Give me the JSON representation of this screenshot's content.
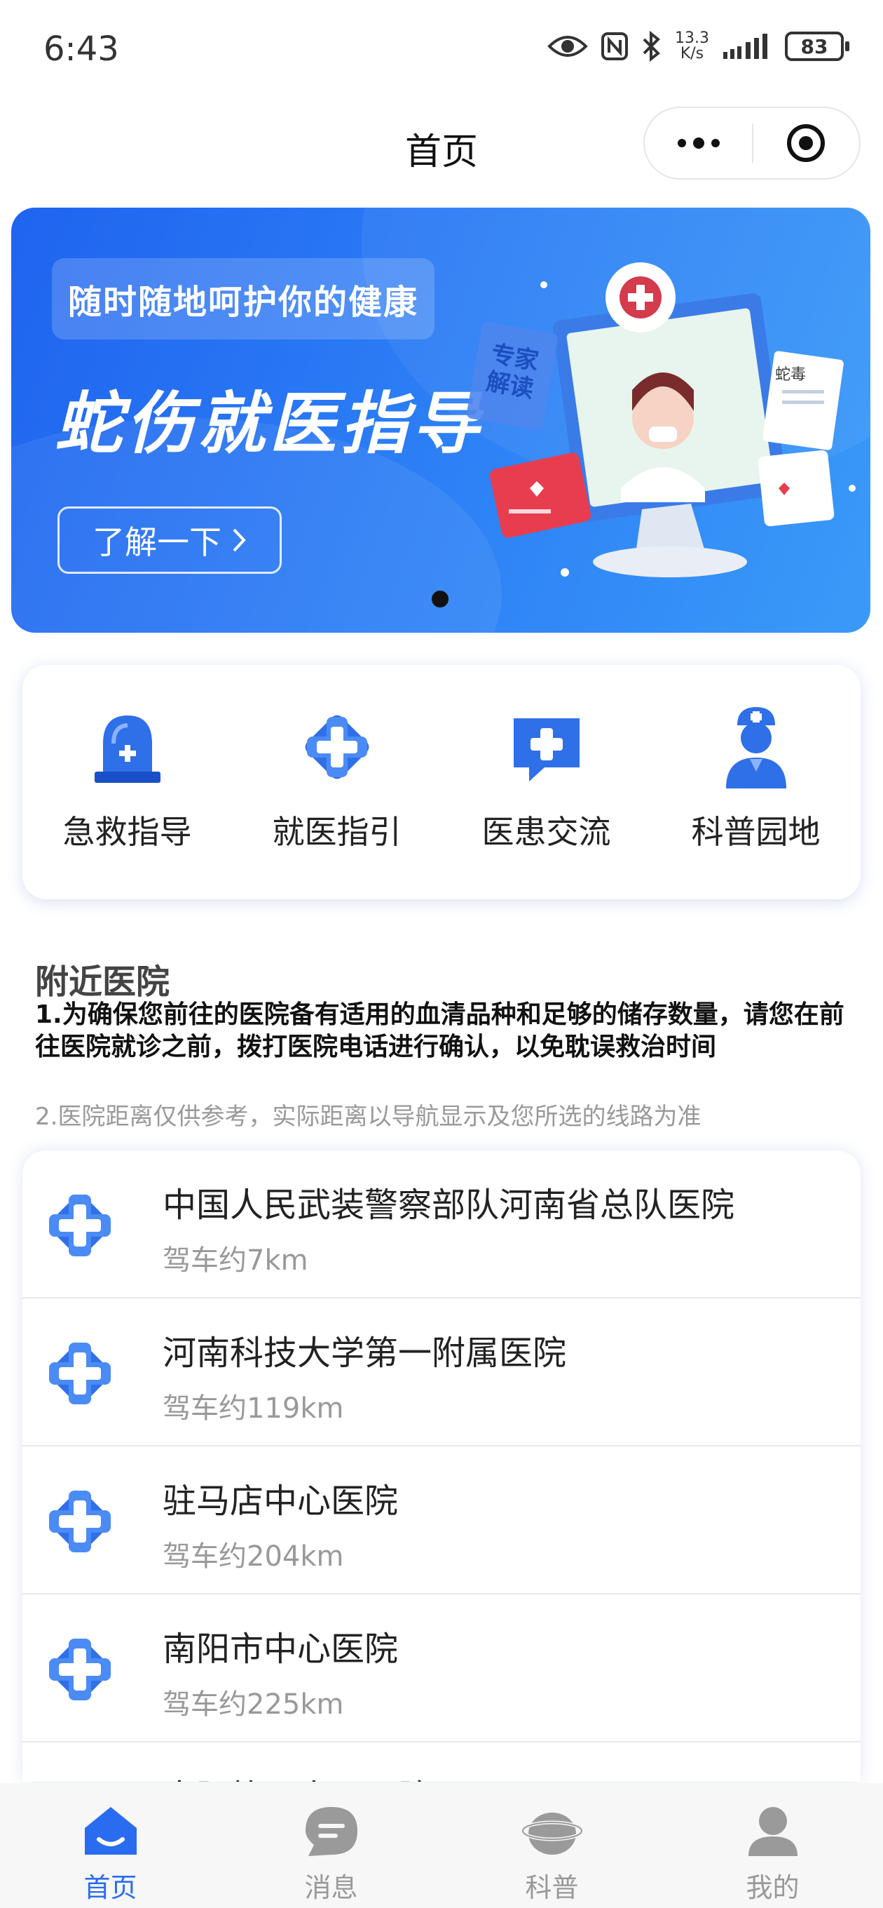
{
  "status_bar": {
    "time": "6:43",
    "net_speed_top": "13.3",
    "net_speed_bottom": "K/s",
    "battery": "83"
  },
  "navbar": {
    "title": "首页"
  },
  "banner": {
    "slogan": "随时随地呵护你的健康",
    "headline": "蛇伤就医指导",
    "button_label": "了解一下",
    "illus_tag_1": "专家",
    "illus_tag_2": "解读",
    "illus_doc_label": "蛇毒"
  },
  "quick_entries": [
    {
      "label": "急救指导",
      "icon": "alarm-light-icon"
    },
    {
      "label": "就医指引",
      "icon": "medical-cross-icon"
    },
    {
      "label": "医患交流",
      "icon": "chat-cross-icon"
    },
    {
      "label": "科普园地",
      "icon": "nurse-icon"
    }
  ],
  "nearby": {
    "title": "附近医院",
    "note1": "1.为确保您前往的医院备有适用的血清品种和足够的储存数量，请您在前往医院就诊之前，拨打医院电话进行确认，以免耽误救治时间",
    "note2": "2.医院距离仅供参考，实际距离以导航显示及您所选的线路为准",
    "hospitals": [
      {
        "name": "中国人民武装警察部队河南省总队医院",
        "distance": "驾车约7km"
      },
      {
        "name": "河南科技大学第一附属医院",
        "distance": "驾车约119km"
      },
      {
        "name": "驻马店中心医院",
        "distance": "驾车约204km"
      },
      {
        "name": "南阳市中心医院",
        "distance": "驾车约225km"
      },
      {
        "name": "南阳第一人民医院",
        "distance": ""
      }
    ]
  },
  "tabbar": [
    {
      "label": "首页",
      "icon": "home-icon",
      "active": true
    },
    {
      "label": "消息",
      "icon": "message-icon",
      "active": false
    },
    {
      "label": "科普",
      "icon": "science-icon",
      "active": false
    },
    {
      "label": "我的",
      "icon": "profile-icon",
      "active": false
    }
  ],
  "colors": {
    "primary": "#2a6cf0",
    "banner_start": "#1f64ef",
    "banner_end": "#3a9af8",
    "muted": "#999999"
  }
}
